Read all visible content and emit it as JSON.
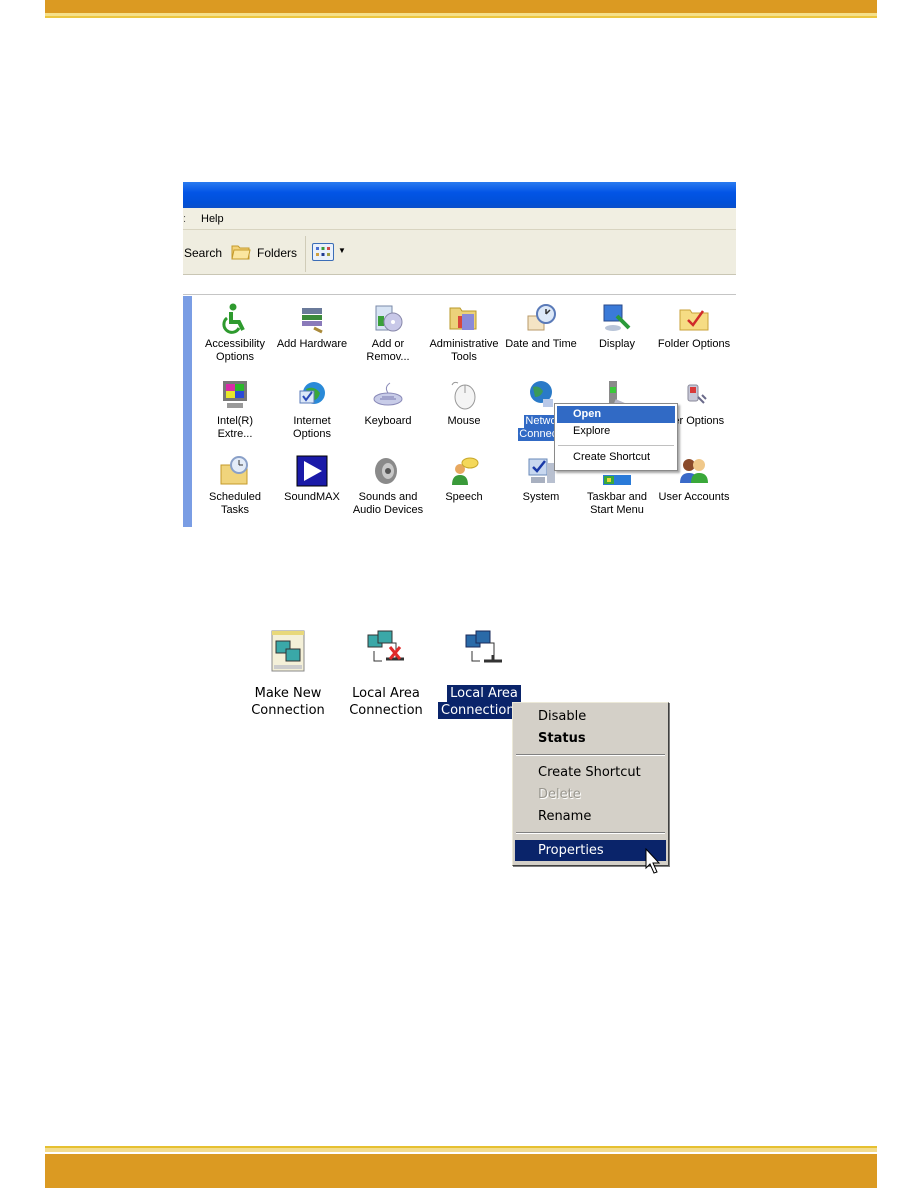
{
  "page": {
    "accent_color": "#db9a22"
  },
  "control_panel": {
    "menu": {
      "partial_left": ":",
      "help": "Help"
    },
    "toolbar": {
      "search": "Search",
      "folders": "Folders",
      "views_icon": "views-icon"
    },
    "items": [
      {
        "label1": "Accessibility",
        "label2": "Options",
        "icon": "accessibility-icon"
      },
      {
        "label1": "Add Hardware",
        "label2": "",
        "icon": "add-hardware-icon"
      },
      {
        "label1": "Add or",
        "label2": "Remov...",
        "icon": "add-remove-programs-icon"
      },
      {
        "label1": "Administrative",
        "label2": "Tools",
        "icon": "administrative-tools-icon"
      },
      {
        "label1": "Date and Time",
        "label2": "",
        "icon": "date-time-icon"
      },
      {
        "label1": "Display",
        "label2": "",
        "icon": "display-icon"
      },
      {
        "label1": "Folder Options",
        "label2": "",
        "icon": "folder-options-icon"
      },
      {
        "label1": "Intel(R)",
        "label2": "Extre...",
        "icon": "intel-graphics-icon"
      },
      {
        "label1": "Internet",
        "label2": "Options",
        "icon": "internet-options-icon"
      },
      {
        "label1": "Keyboard",
        "label2": "",
        "icon": "keyboard-icon"
      },
      {
        "label1": "Mouse",
        "label2": "",
        "icon": "mouse-icon"
      },
      {
        "label1": "Netwo",
        "label2": "Connecti",
        "icon": "network-connections-icon",
        "selected": true
      },
      {
        "label1": "",
        "label2": "",
        "icon": "phone-modem-icon"
      },
      {
        "label1": "ver Options",
        "label2": "",
        "icon": "power-options-icon"
      },
      {
        "label1": "Scheduled",
        "label2": "Tasks",
        "icon": "scheduled-tasks-icon"
      },
      {
        "label1": "SoundMAX",
        "label2": "",
        "icon": "soundmax-icon"
      },
      {
        "label1": "Sounds and",
        "label2": "Audio Devices",
        "icon": "sounds-icon"
      },
      {
        "label1": "Speech",
        "label2": "",
        "icon": "speech-icon"
      },
      {
        "label1": "System",
        "label2": "",
        "icon": "system-icon"
      },
      {
        "label1": "Taskbar and",
        "label2": "Start Menu",
        "icon": "taskbar-icon"
      },
      {
        "label1": "User Accounts",
        "label2": "",
        "icon": "user-accounts-icon"
      }
    ],
    "context_menu": {
      "open": "Open",
      "explore": "Explore",
      "create_shortcut": "Create Shortcut"
    }
  },
  "network_connections": {
    "items": [
      {
        "label1": "Make New",
        "label2": "Connection",
        "icon": "make-new-connection-icon"
      },
      {
        "label1": "Local Area",
        "label2": "Connection",
        "icon": "lan-disconnected-icon"
      },
      {
        "label1": "Local Area",
        "label2": "Connection 2",
        "icon": "lan-connected-icon",
        "selected": true
      }
    ],
    "context_menu": {
      "disable": "Disable",
      "status": "Status",
      "create_shortcut": "Create Shortcut",
      "delete": "Delete",
      "rename": "Rename",
      "properties": "Properties"
    }
  }
}
